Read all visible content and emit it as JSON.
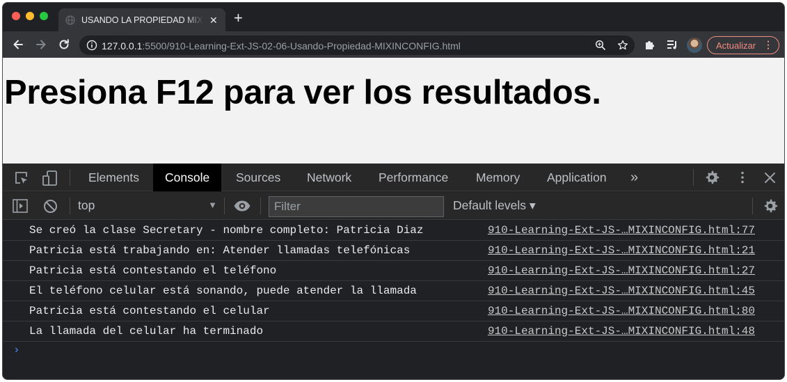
{
  "tab": {
    "title": "USANDO LA PROPIEDAD MIXINCONFIG"
  },
  "toolbar": {
    "url_host": "127.0.0.1",
    "url_rest": ":5500/910-Learning-Ext-JS-02-06-Usando-Propiedad-MIXINCONFIG.html",
    "update_label": "Actualizar"
  },
  "page": {
    "heading": "Presiona F12 para ver los resultados."
  },
  "devtools": {
    "tabs": [
      "Elements",
      "Console",
      "Sources",
      "Network",
      "Performance",
      "Memory",
      "Application"
    ],
    "active_tab": "Console",
    "more_tabs": "»",
    "context": "top",
    "filter_placeholder": "Filter",
    "levels": "Default levels ▾",
    "logs": [
      {
        "message": "Se creó la clase Secretary - nombre completo: Patricia Diaz",
        "source": "910-Learning-Ext-JS-…MIXINCONFIG.html:77"
      },
      {
        "message": "Patricia está trabajando en: Atender llamadas telefónicas",
        "source": "910-Learning-Ext-JS-…MIXINCONFIG.html:21"
      },
      {
        "message": "Patricia está contestando el teléfono",
        "source": "910-Learning-Ext-JS-…MIXINCONFIG.html:27"
      },
      {
        "message": "El teléfono celular está sonando, puede atender la llamada",
        "source": "910-Learning-Ext-JS-…MIXINCONFIG.html:45"
      },
      {
        "message": "Patricia está contestando el celular",
        "source": "910-Learning-Ext-JS-…MIXINCONFIG.html:80"
      },
      {
        "message": "La llamada del celular ha terminado",
        "source": "910-Learning-Ext-JS-…MIXINCONFIG.html:48"
      }
    ],
    "prompt_symbol": "›"
  },
  "colors": {
    "accent_update": "#f28b82",
    "prompt": "#4c8df6",
    "active_tab_bg": "#000000"
  }
}
